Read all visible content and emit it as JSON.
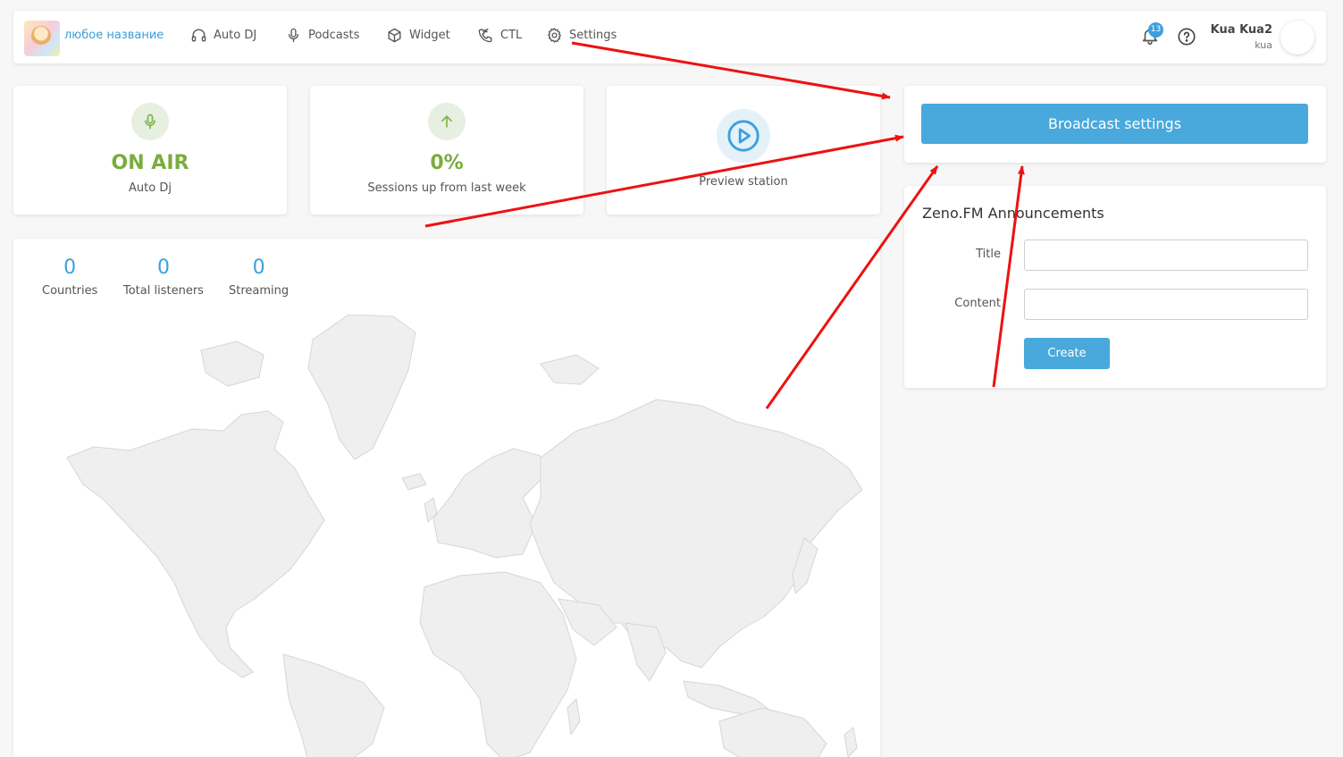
{
  "nav": {
    "station_name": "любое название",
    "items": [
      {
        "label": "Auto DJ",
        "icon": "headphones-icon"
      },
      {
        "label": "Podcasts",
        "icon": "microphone-icon"
      },
      {
        "label": "Widget",
        "icon": "cube-icon"
      },
      {
        "label": "CTL",
        "icon": "phone-icon"
      },
      {
        "label": "Settings",
        "icon": "gear-icon"
      }
    ],
    "notification_count": "13",
    "user_name": "Kua Kua2",
    "user_login": "kua"
  },
  "stats": {
    "onair": {
      "value": "ON AIR",
      "label": "Auto Dj"
    },
    "sessions": {
      "value": "0%",
      "label": "Sessions up from last week"
    },
    "preview": {
      "label": "Preview station"
    }
  },
  "metrics": [
    {
      "value": "0",
      "label": "Countries"
    },
    {
      "value": "0",
      "label": "Total listeners"
    },
    {
      "value": "0",
      "label": "Streaming"
    }
  ],
  "broadcast": {
    "button_label": "Broadcast settings"
  },
  "announcements": {
    "title": "Zeno.FM Announcements",
    "title_label": "Title",
    "content_label": "Content",
    "title_value": "",
    "content_value": "",
    "create_label": "Create"
  },
  "colors": {
    "accent_blue": "#49a8dc",
    "onair_green": "#79ad3c",
    "annotation_red": "#ee1111"
  }
}
